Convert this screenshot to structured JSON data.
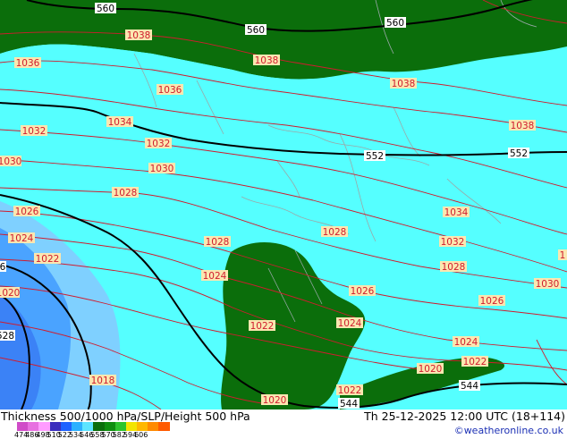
{
  "title_left": "Thickness 500/1000 hPa/SLP/Height 500 hPa",
  "title_right": "Th 25-12-2025 12:00 UTC (18+114)",
  "credit": "©weatheronline.co.uk",
  "colors": {
    "land_dark": "#0b6e0b",
    "sea_cyan": "#55ffff",
    "blue_mid": "#4aa3ff",
    "blue_light": "#7fd0ff",
    "slp_line": "#d01c2e",
    "border_line": "#9aa8a8"
  },
  "colorbar": {
    "colors": [
      "#d04cc8",
      "#e770e0",
      "#ff9cff",
      "#3a2dbd",
      "#1e62ff",
      "#2bb0ff",
      "#5ce4ff",
      "#0b6e0b",
      "#0f8e0f",
      "#2cc42c",
      "#f2e400",
      "#ffb800",
      "#ff8a00",
      "#ff5a00"
    ],
    "ticks": [
      "474",
      "486",
      "498",
      "510",
      "522",
      "534",
      "546",
      "558",
      "570",
      "582",
      "594",
      "606"
    ]
  },
  "height500_labels": [
    "560",
    "560",
    "560",
    "552",
    "552",
    "544",
    "6",
    "528"
  ],
  "slp_labels": [
    "1038",
    "1038",
    "1038",
    "1038",
    "1036",
    "1036",
    "1034",
    "1034",
    "1032",
    "1032",
    "1032",
    "1030",
    "1030",
    "1030",
    "1028",
    "1028",
    "1028",
    "1028",
    "1026",
    "1026",
    "1026",
    "1024",
    "1024",
    "1024",
    "1024",
    "1022",
    "1022",
    "1022",
    "1022",
    "1020",
    "1020",
    "1020",
    "1018",
    "1"
  ]
}
